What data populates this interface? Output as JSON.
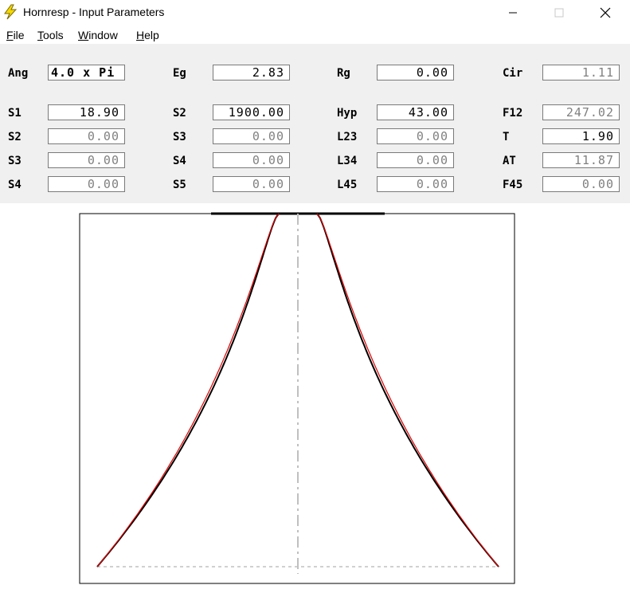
{
  "window": {
    "title": "Hornresp - Input Parameters",
    "icon": "lightning-bolt-icon",
    "controls": [
      "minimize-icon",
      "maximize-icon",
      "close-icon"
    ]
  },
  "menu": {
    "file": {
      "first": "F",
      "rest": "ile"
    },
    "tools": {
      "first": "T",
      "rest": "ools"
    },
    "window": {
      "first": "W",
      "rest": "indow"
    },
    "help": {
      "first": "H",
      "rest": "elp"
    }
  },
  "params": {
    "rows": [
      [
        {
          "label": "Ang",
          "value": "4.0 x Pi",
          "state": "active-left"
        },
        {
          "label": "Eg",
          "value": "2.83",
          "state": "active"
        },
        {
          "label": "Rg",
          "value": "0.00",
          "state": "active"
        },
        {
          "label": "Cir",
          "value": "1.11",
          "state": "inactive"
        }
      ],
      [
        {
          "label": "S1",
          "value": "18.90",
          "state": "active"
        },
        {
          "label": "S2",
          "value": "1900.00",
          "state": "active"
        },
        {
          "label": "Hyp",
          "value": "43.00",
          "state": "active"
        },
        {
          "label": "F12",
          "value": "247.02",
          "state": "inactive"
        }
      ],
      [
        {
          "label": "S2",
          "value": "0.00",
          "state": "inactive"
        },
        {
          "label": "S3",
          "value": "0.00",
          "state": "inactive"
        },
        {
          "label": "L23",
          "value": "0.00",
          "state": "inactive"
        },
        {
          "label": "T",
          "value": "1.90",
          "state": "active"
        }
      ],
      [
        {
          "label": "S3",
          "value": "0.00",
          "state": "inactive"
        },
        {
          "label": "S4",
          "value": "0.00",
          "state": "inactive"
        },
        {
          "label": "L34",
          "value": "0.00",
          "state": "inactive"
        },
        {
          "label": "AT",
          "value": "11.87",
          "state": "inactive"
        }
      ],
      [
        {
          "label": "S4",
          "value": "0.00",
          "state": "inactive"
        },
        {
          "label": "S5",
          "value": "0.00",
          "state": "inactive"
        },
        {
          "label": "L45",
          "value": "0.00",
          "state": "inactive"
        },
        {
          "label": "F45",
          "value": "0.00",
          "state": "inactive"
        }
      ]
    ]
  },
  "colors": {
    "panel_bg": "#f0f0f0",
    "curve_red": "#e00000",
    "curve_black": "#000000",
    "axis_gray": "#c0c0c0",
    "icon_yellow": "#f5d800"
  }
}
